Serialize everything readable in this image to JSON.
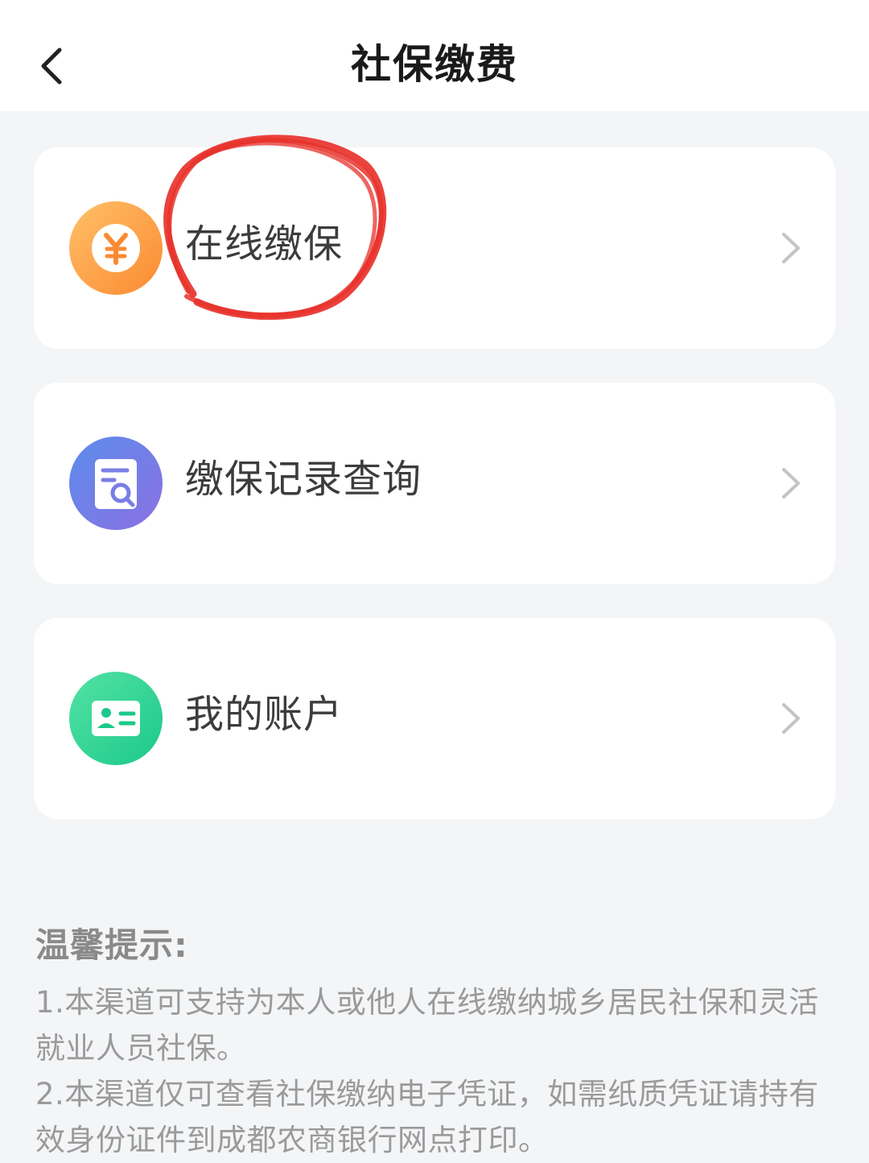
{
  "header": {
    "title": "社保缴费",
    "back_icon": "chevron-left-icon"
  },
  "menu": [
    {
      "label": "在线缴保",
      "icon": "yuan-coin-icon",
      "color": "#fb8a32"
    },
    {
      "label": "缴保记录查询",
      "icon": "document-search-icon",
      "color": "#7a7ee6"
    },
    {
      "label": "我的账户",
      "icon": "id-card-icon",
      "color": "#1cc98a"
    }
  ],
  "annotation": {
    "color": "#e8322c",
    "target": "在线缴保"
  },
  "notice": {
    "title": "温馨提示:",
    "line1": "1.本渠道可支持为本人或他人在线缴纳城乡居民社保和灵活就业人员社保。",
    "line2": "2.本渠道仅可查看社保缴纳电子凭证，如需纸质凭证请持有效身份证件到成都农商银行网点打印。"
  }
}
